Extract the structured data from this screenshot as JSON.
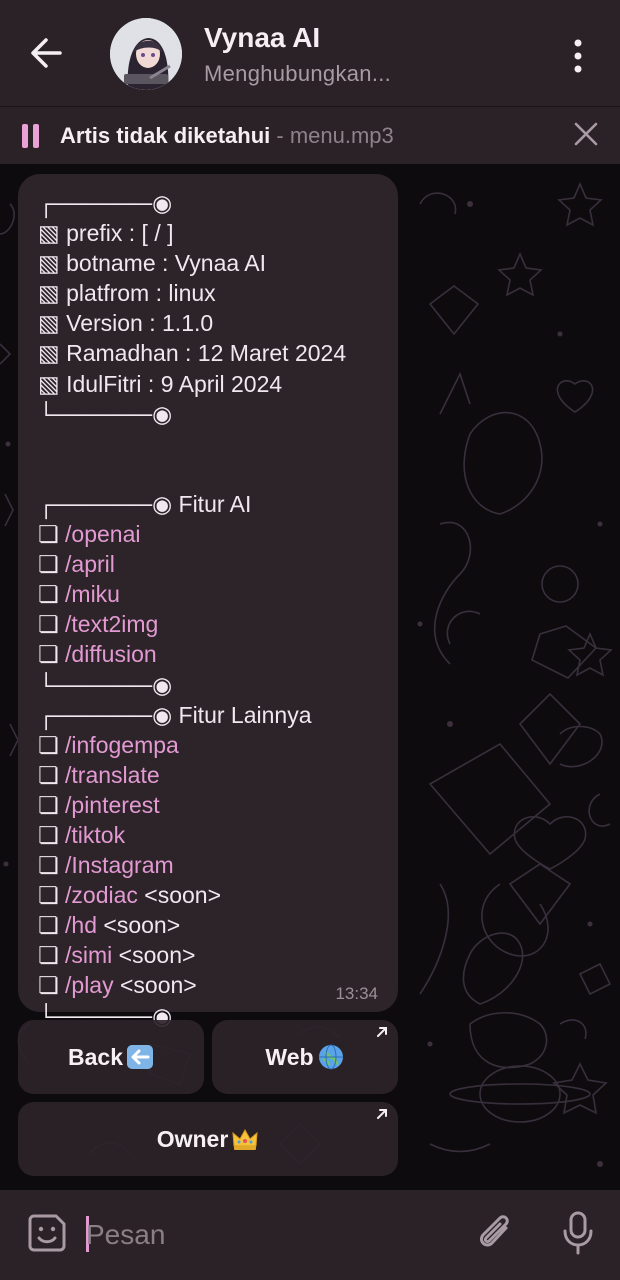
{
  "header": {
    "title": "Vynaa AI",
    "status": "Menghubungkan..."
  },
  "audio": {
    "artist": "Artis tidak diketahui",
    "file": " - menu.mp3"
  },
  "message": {
    "lines": [
      "┌──────◉",
      "▧ prefix : [ / ]",
      "▧ botname : Vynaa AI",
      "▧ platfrom : linux",
      "▧ Version : 1.1.0",
      "▧ Ramadhan : 12 Maret 2024",
      "▧ IdulFitri : 9 April 2024",
      "└──────◉",
      "",
      "",
      "┌──────◉ Fitur AI",
      "❏ |/openai",
      "❏ |/april",
      "❏ |/miku",
      "❏ |/text2img",
      "❏ |/diffusion",
      "└──────◉",
      "┌──────◉ Fitur Lainnya",
      "❏ |/infogempa",
      "❏ |/translate",
      "❏ |/pinterest",
      "❏ |/tiktok",
      "❏ |/Instagram",
      "❏ |/zodiac| <soon>",
      "❏ |/hd| <soon>",
      "❏ |/simi| <soon>",
      "❏ |/play| <soon>",
      "└──────◉"
    ],
    "time": "13:34"
  },
  "keyboard": {
    "back_label": "Back",
    "back_icon": "left-arrow-emoji-icon",
    "web_label": "Web",
    "web_icon": "globe-emoji-icon",
    "owner_label": "Owner",
    "owner_icon": "crown-emoji-icon"
  },
  "input": {
    "placeholder": "Pesan"
  },
  "colors": {
    "accent": "#e39ad3",
    "bubble": "#2c2429",
    "bar": "#2a2227"
  }
}
